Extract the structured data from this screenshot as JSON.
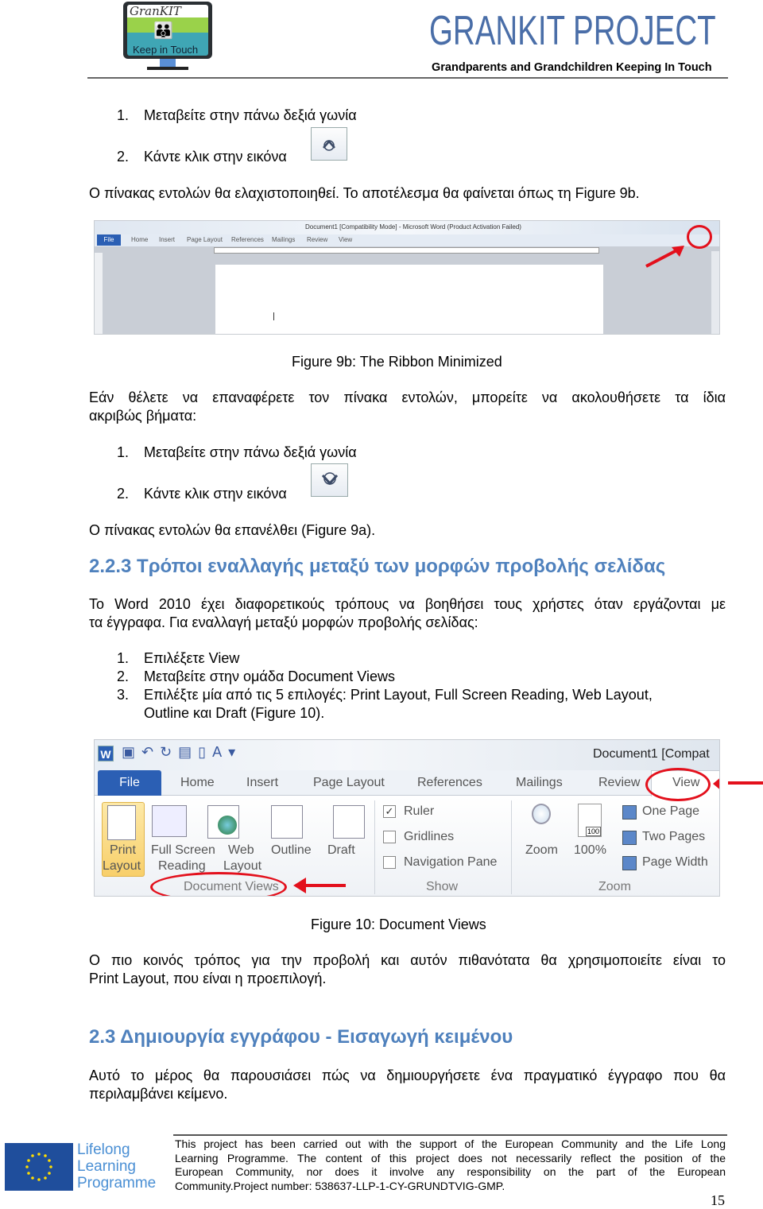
{
  "header": {
    "logo_text_top": "GranKIT",
    "logo_text_bottom": "Keep in Touch",
    "title": "GRANKIT PROJECT",
    "subtitle": "Grandparents and Grandchildren Keeping In Touch",
    "colors": {
      "title": "#4a6ea8",
      "rule": "#666666"
    }
  },
  "section1": {
    "steps": [
      {
        "num": "1.",
        "text": "Μεταβείτε στην πάνω δεξιά γωνία"
      },
      {
        "num": "2.",
        "text": "Κάντε κλικ στην εικόνα"
      }
    ],
    "step_icon": "chevron-up-icon",
    "result": "Ο πίνακας εντολών θα ελαχιστοποιηθεί. Το αποτέλεσμα θα φαίνεται όπως τη Figure 9b."
  },
  "figure9b": {
    "window_title": "Document1 [Compatibility Mode] - Microsoft Word (Product Activation Failed)",
    "tabs": [
      "File",
      "Home",
      "Insert",
      "Page Layout",
      "References",
      "Mailings",
      "Review",
      "View"
    ],
    "caption": "Figure 9b: The Ribbon Minimized"
  },
  "section2": {
    "intro": "Εάν θέλετε να επαναφέρετε τον πίνακα εντολών, μπορείτε να ακολουθήσετε τα ίδια",
    "intro2": "ακριβώς βήματα:",
    "steps": [
      {
        "num": "1.",
        "text": "Μεταβείτε στην πάνω δεξιά γωνία"
      },
      {
        "num": "2.",
        "text": "Κάντε κλικ στην εικόνα"
      }
    ],
    "step_icon": "chevron-down-icon",
    "result": "Ο πίνακας εντολών θα επανέλθει (Figure 9a)."
  },
  "heading223": "2.2.3 Τρόποι εναλλαγής μεταξύ των μορφών προβολής σελίδας",
  "section3": {
    "para1": "Το Word 2010 έχει διαφορετικούς τρόπους να βοηθήσει τους χρήστες όταν εργάζονται με",
    "para2": "τα έγγραφα. Για εναλλαγή μεταξύ μορφών προβολής σελίδας:",
    "steps": [
      {
        "num": "1.",
        "text": "Επιλέξετε View"
      },
      {
        "num": "2.",
        "text": "Μεταβείτε στην ομάδα Document Views"
      },
      {
        "num": "3.",
        "text": "Επιλέξτε μία από τις 5 επιλογές: Print Layout, Full Screen Reading, Web Layout,",
        "text2": "Outline και Draft (Figure 10)."
      }
    ]
  },
  "figure10": {
    "window_title": "Document1 [Compat",
    "tabs": [
      "File",
      "Home",
      "Insert",
      "Page Layout",
      "References",
      "Mailings",
      "Review",
      "View"
    ],
    "views": [
      {
        "l1": "Print",
        "l2": "Layout"
      },
      {
        "l1": "Full Screen",
        "l2": "Reading"
      },
      {
        "l1": "Web",
        "l2": "Layout"
      },
      {
        "l1": "Outline",
        "l2": ""
      },
      {
        "l1": "Draft",
        "l2": ""
      }
    ],
    "group_views": "Document Views",
    "show": [
      {
        "label": "Ruler",
        "checked": true
      },
      {
        "label": "Gridlines",
        "checked": false
      },
      {
        "label": "Navigation Pane",
        "checked": false
      }
    ],
    "group_show": "Show",
    "zoom": [
      "Zoom",
      "100%"
    ],
    "zoom_badge": "100",
    "pages": [
      "One Page",
      "Two Pages",
      "Page Width"
    ],
    "group_zoom": "Zoom",
    "caption": "Figure 10: Document Views"
  },
  "section4": {
    "para1": "Ο πιο κοινός τρόπος για την προβολή και αυτόν πιθανότατα θα χρησιμοποιείτε είναι το",
    "para2": "Print Layout, που είναι η προεπιλογή."
  },
  "heading23": "2.3 Δημιουργία εγγράφου - Εισαγωγή κειμένου",
  "section5": {
    "para1": "Αυτό το μέρος θα παρουσιάσει πώς να δημιουργήσετε ένα πραγματικό έγγραφο που θα",
    "para2": "περιλαμβάνει κείμενο."
  },
  "footer": {
    "logo_lines": [
      "Lifelong",
      "Learning",
      "Programme"
    ],
    "lines": [
      "This project has been carried out with the support of the European Community and the Life Long",
      "Learning Programme. The content of this project does not necessarily reflect the position of the",
      "European Community, nor does it involve any responsibility on the part of the European"
    ],
    "last_line": "Community.Project number: 538637-LLP-1-CY-GRUNDTVIG-GMP.",
    "page_number": "15",
    "colors": {
      "eu_blue": "#1f4e9c",
      "stars": "#ffdd00"
    }
  }
}
